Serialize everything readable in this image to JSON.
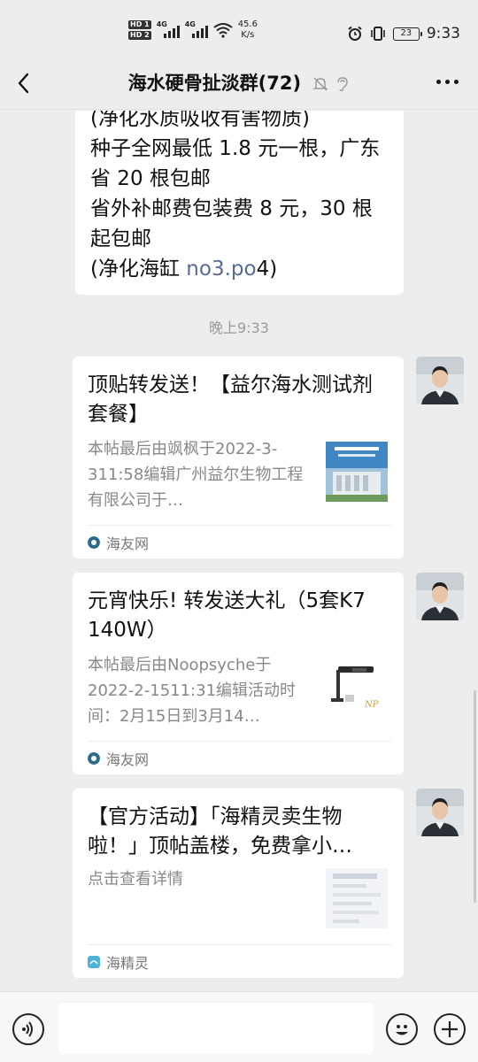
{
  "status_bar": {
    "hd1": "HD 1",
    "hd2": "HD 2",
    "net1": "4G",
    "net2": "4G",
    "speed_value": "45.6",
    "speed_unit": "K/s",
    "battery": "23",
    "time": "9:33"
  },
  "nav": {
    "title": "海水硬骨扯淡群(72)"
  },
  "messages": {
    "text_tail": {
      "line1": "(净化水质吸收有害物质)",
      "line2": "种子全网最低 1.8 元一根，广东省 20 根包邮",
      "line3": "省外补邮费包装费 8 元，30 根起包邮",
      "line4_prefix": "(净化海缸 ",
      "line4_link": "no3.po",
      "line4_suffix": "4)"
    },
    "timestamp": "晚上9:33",
    "cards": [
      {
        "title": "顶贴转发送！【益尔海水测试剂套餐】",
        "desc": "本帖最后由飒枫于2022-3-311:58编辑广州益尔生物工程有限公司于…",
        "source": "海友网"
      },
      {
        "title": "元宵快乐! 转发送大礼（5套K7 140W）",
        "desc": "本帖最后由Noopsyche于2022-2-1511:31编辑活动时间：2月15日到3月14…",
        "source": "海友网"
      },
      {
        "title": "【官方活动】「海精灵卖生物啦！」顶帖盖楼，免费拿小…",
        "desc": "点击查看详情",
        "source": "海精灵"
      }
    ]
  },
  "colors": {
    "background": "#ededed",
    "bubble": "#ffffff",
    "link": "#576b95",
    "muted_text": "#888888"
  }
}
